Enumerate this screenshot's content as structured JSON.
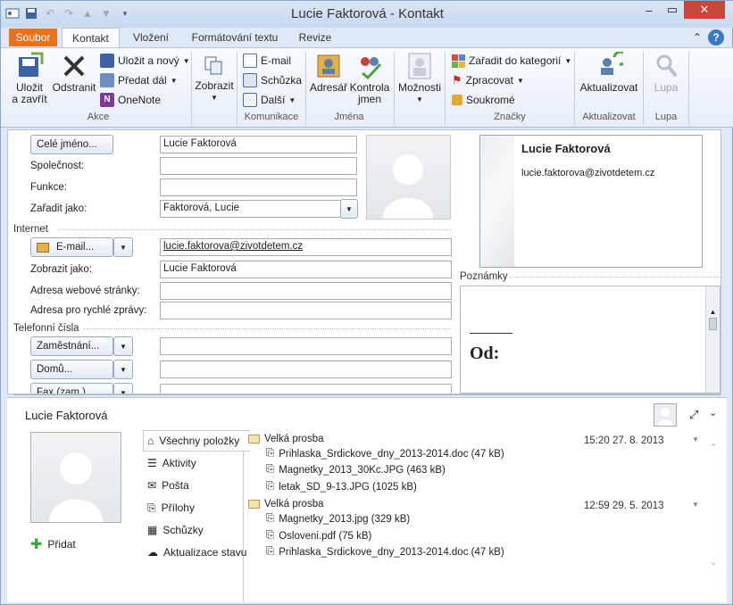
{
  "window": {
    "title": "Lucie Faktorová  -  Kontakt"
  },
  "tabs": {
    "file": "Soubor",
    "contact": "Kontakt",
    "insert": "Vložení",
    "format": "Formátování textu",
    "review": "Revize"
  },
  "ribbon": {
    "save_close": "Uložit\na zavřít",
    "delete": "Odstranit",
    "save_new": "Uložit a nový",
    "forward": "Předat dál",
    "onenote": "OneNote",
    "actions_group": "Akce",
    "show": "Zobrazit",
    "email": "E-mail",
    "meeting": "Schůzka",
    "more": "Další",
    "communicate_group": "Komunikace",
    "address_book": "Adresář",
    "check_names": "Kontrola\njmen",
    "names_group": "Jména",
    "options": "Možnosti",
    "categorize": "Zařadit do kategorií",
    "followup": "Zpracovat",
    "private": "Soukromé",
    "tags_group": "Značky",
    "update": "Aktualizovat",
    "update_group": "Aktualizovat",
    "zoom": "Lupa",
    "zoom_group": "Lupa"
  },
  "form": {
    "full_name_btn": "Celé jméno...",
    "full_name": "Lucie Faktorová",
    "company_label": "Společnost:",
    "company": "",
    "job_label": "Funkce:",
    "job": "",
    "file_as_label": "Zařadit jako:",
    "file_as": "Faktorová, Lucie",
    "internet_section": "Internet",
    "email_btn": "E-mail...",
    "email": "lucie.faktorova@zivotdetem.cz",
    "display_as_label": "Zobrazit jako:",
    "display_as": "Lucie Faktorová",
    "web_label": "Adresa webové stránky:",
    "web": "",
    "im_label": "Adresa pro rychlé zprávy:",
    "im": "",
    "phone_section": "Telefonní čísla",
    "work_btn": "Zaměstnání...",
    "work": "",
    "home_btn": "Domů...",
    "home": "",
    "fax_btn": "Fax (zam.)...",
    "fax": ""
  },
  "card": {
    "name": "Lucie Faktorová",
    "email": "lucie.faktorova@zivotdetem.cz"
  },
  "notes": {
    "label": "Poznámky",
    "content": "Od:"
  },
  "people_pane": {
    "name": "Lucie Faktorová",
    "add": "Přidat",
    "nav": [
      "Všechny položky",
      "Aktivity",
      "Pošta",
      "Přílohy",
      "Schůzky",
      "Aktualizace stavu"
    ],
    "messages": [
      {
        "subject": "Velká prosba",
        "date": "15:20  27. 8. 2013",
        "attachments": [
          "Prihlaska_Srdickove_dny_2013-2014.doc (47 kB)",
          "Magnetky_2013_30Kc.JPG (463 kB)",
          "letak_SD_9-13.JPG (1025 kB)"
        ]
      },
      {
        "subject": "Velká prosba",
        "date": "12:59  29. 5. 2013",
        "attachments": [
          "Magnetky_2013.jpg (329 kB)",
          "Osloveni.pdf (75 kB)",
          "Prihlaska_Srdickove_dny_2013-2014.doc (47 kB)"
        ]
      }
    ]
  },
  "colors": {
    "file_tab": "#e8731b",
    "accent": "#2b579a",
    "title_bg": "#d9e6f5"
  }
}
